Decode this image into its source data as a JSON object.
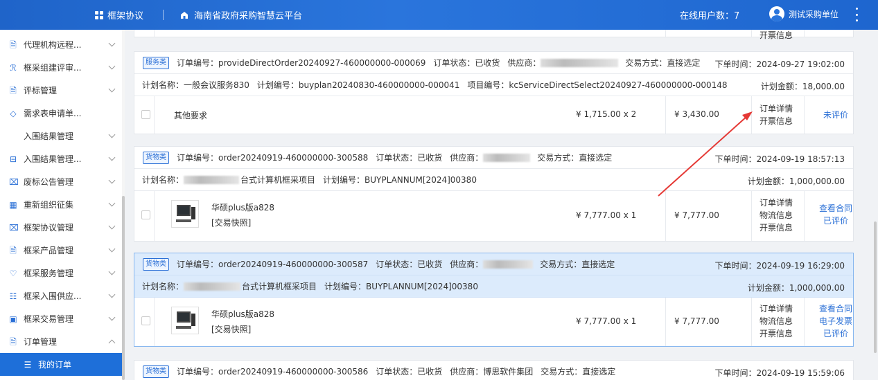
{
  "header": {
    "nav_label": "框架协议",
    "platform_name": "海南省政府采购智慧云平台",
    "online_users": "在线用户数：7",
    "user_name": "测试采购单位"
  },
  "sidebar": {
    "items": [
      {
        "label": "代理机构远程...",
        "icon": "doc-icon"
      },
      {
        "label": "框采组建评审...",
        "icon": "users-icon"
      },
      {
        "label": "评标管理",
        "icon": "doc-icon"
      },
      {
        "label": "需求表申请单...",
        "icon": "diamond-icon"
      },
      {
        "label": "入围结果管理",
        "icon": ""
      },
      {
        "label": "入围结果管理...",
        "icon": "folder-icon"
      },
      {
        "label": "废标公告管理",
        "icon": "notice-icon"
      },
      {
        "label": "重新组织征集",
        "icon": "grid-icon"
      },
      {
        "label": "框架协议管理",
        "icon": "notice-icon"
      },
      {
        "label": "框采产品管理",
        "icon": "doc-icon"
      },
      {
        "label": "框采服务管理",
        "icon": "heart-icon"
      },
      {
        "label": "框采入围供应...",
        "icon": "list-icon"
      },
      {
        "label": "框采交易管理",
        "icon": "wallet-icon"
      },
      {
        "label": "订单管理",
        "icon": "order-icon"
      },
      {
        "label": "我的订单",
        "icon": "my-order-icon"
      }
    ]
  },
  "orders": [
    {
      "tag": "服务类",
      "order_no": "订单编号：provideDirectOrder20240927-460000000-000069",
      "status": "订单状态：已收货",
      "supplier": "供应商：",
      "trade": "交易方式：直接选定",
      "time": "下单时间：2024-09-27 19:02:00",
      "plan_name": "计划名称：一般会议服务830",
      "plan_no": "计划编号：buyplan20240830-460000000-000041",
      "project_no": "项目编号：kcServiceDirectSelect20240927-460000000-000148",
      "plan_amount": "计划金额：18,000.00",
      "item_name": "其他要求",
      "price": "¥ 1,715.00 x 2",
      "total": "¥ 3,430.00",
      "info_links": [
        "订单详情",
        "开票信息"
      ],
      "actions": [
        "未评价"
      ]
    },
    {
      "tag": "货物类",
      "order_no": "订单编号：order20240919-460000000-300588",
      "status": "订单状态：已收货",
      "supplier": "供应商：",
      "trade": "交易方式：直接选定",
      "time": "下单时间：2024-09-19 18:57:13",
      "plan_name": "计划名称：",
      "plan_name_tail": "台式计算机框采项目",
      "plan_no": "计划编号：BUYPLANNUM[2024]00380",
      "plan_amount": "计划金额：1,000,000.00",
      "item_name": "华硕plus版a828",
      "item_sub": "[交易快照]",
      "price": "¥ 7,777.00 x 1",
      "total": "¥ 7,777.00",
      "info_links": [
        "订单详情",
        "物流信息",
        "开票信息"
      ],
      "actions": [
        "查看合同",
        "已评价"
      ]
    },
    {
      "tag": "货物类",
      "order_no": "订单编号：order20240919-460000000-300587",
      "status": "订单状态：已收货",
      "supplier": "供应商：",
      "trade": "交易方式：直接选定",
      "time": "下单时间：2024-09-19 16:29:00",
      "plan_name": "计划名称：",
      "plan_name_tail": "台式计算机框采项目",
      "plan_no": "计划编号：BUYPLANNUM[2024]00380",
      "plan_amount": "计划金额：1,000,000.00",
      "item_name": "华硕plus版a828",
      "item_sub": "[交易快照]",
      "price": "¥ 7,777.00 x 1",
      "total": "¥ 7,777.00",
      "info_links": [
        "订单详情",
        "物流信息",
        "开票信息"
      ],
      "actions": [
        "查看合同",
        "电子发票",
        "已评价"
      ]
    },
    {
      "tag": "货物类",
      "order_no": "订单编号：order20240919-460000000-300586",
      "status": "订单状态：已收货",
      "supplier": "供应商：博思软件集团",
      "trade": "交易方式：直接选定",
      "time": "下单时间：2024-09-19 15:59:06"
    }
  ],
  "top_partial": {
    "label": "开票信息"
  },
  "colors": {
    "accent": "#1e6fd9",
    "link": "#2a6fd6",
    "arrow": "#e53935",
    "highlight_bg": "#dcebfc"
  }
}
